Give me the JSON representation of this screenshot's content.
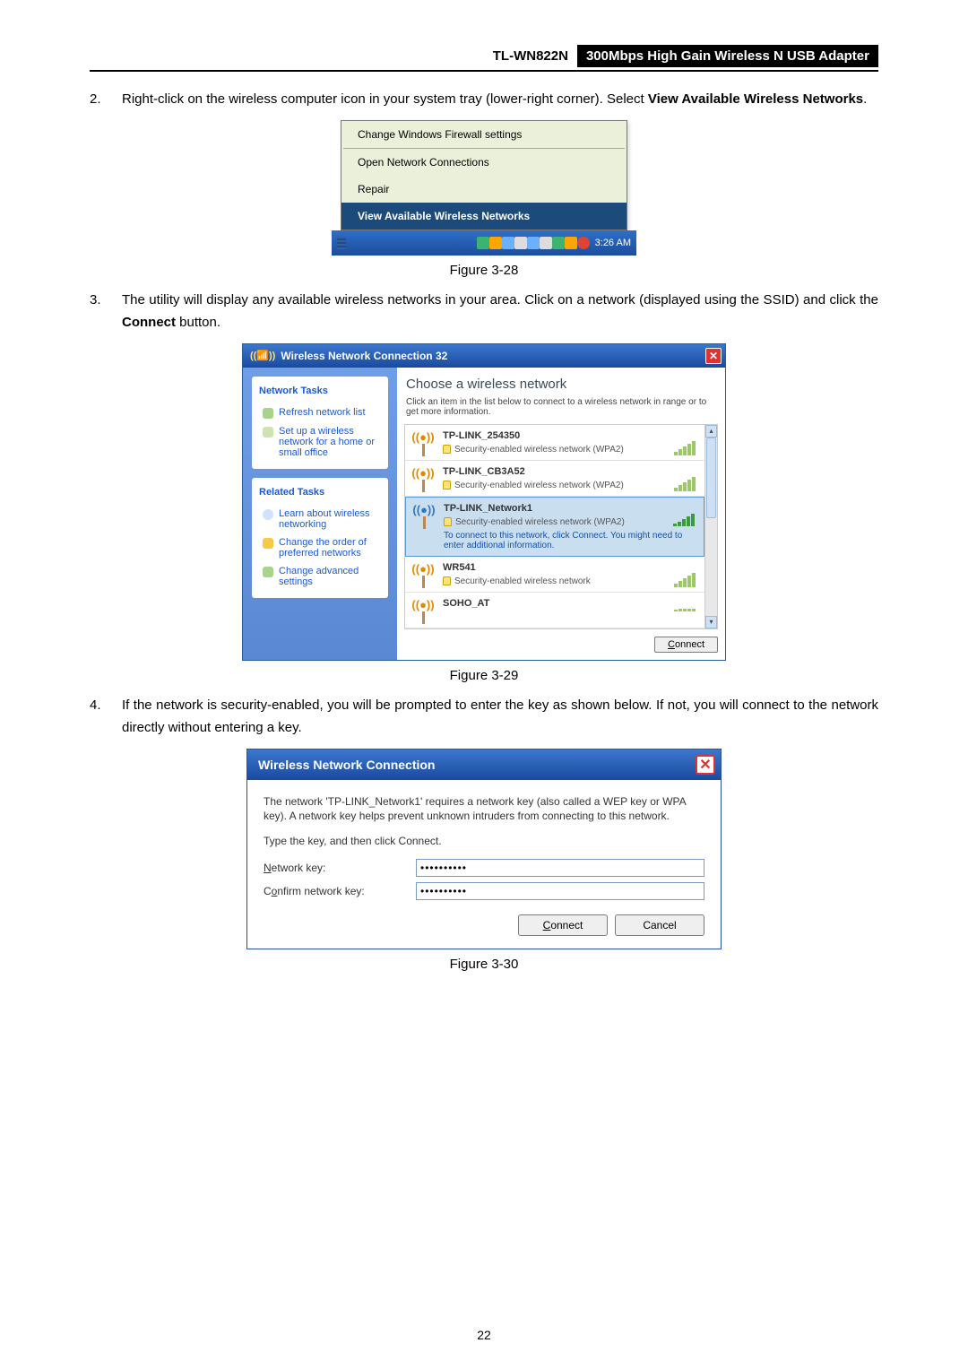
{
  "header": {
    "model": "TL-WN822N",
    "description": "300Mbps High Gain Wireless N USB Adapter"
  },
  "steps": {
    "s2": {
      "num": "2.",
      "text_a": "Right-click on the wireless computer icon in your system tray (lower-right corner). Select ",
      "text_b": "View Available Wireless Networks",
      "text_c": "."
    },
    "s3": {
      "num": "3.",
      "text_a": "The utility will display any available wireless networks in your area. Click on a network (displayed using the SSID) and click the ",
      "text_b": "Connect",
      "text_c": " button."
    },
    "s4": {
      "num": "4.",
      "text_a": "If the network is security-enabled, you will be prompted to enter the key as shown below. If not, you will connect to the network directly without entering a key."
    }
  },
  "captions": {
    "c28": "Figure 3-28",
    "c29": "Figure 3-29",
    "c30": "Figure 3-30"
  },
  "tray": {
    "items": [
      "Change Windows Firewall settings",
      "Open Network Connections",
      "Repair",
      "View Available Wireless Networks"
    ],
    "clock": "3:26 AM"
  },
  "dlg29": {
    "title": "Wireless Network Connection 32",
    "side": {
      "network_tasks": "Network Tasks",
      "refresh": "Refresh network list",
      "setup": "Set up a wireless network for a home or small office",
      "related_tasks": "Related Tasks",
      "learn": "Learn about wireless networking",
      "order": "Change the order of preferred networks",
      "adv": "Change advanced settings"
    },
    "main_heading": "Choose a wireless network",
    "hint": "Click an item in the list below to connect to a wireless network in range or to get more information.",
    "networks": [
      {
        "ssid": "TP-LINK_254350",
        "desc": "Security-enabled wireless network (WPA2)",
        "selected": false,
        "bars": [
          4,
          7,
          10,
          13,
          16
        ]
      },
      {
        "ssid": "TP-LINK_CB3A52",
        "desc": "Security-enabled wireless network (WPA2)",
        "selected": false,
        "bars": [
          4,
          7,
          10,
          13,
          16
        ]
      },
      {
        "ssid": "TP-LINK_Network1",
        "desc": "Security-enabled wireless network (WPA2)",
        "selected": true,
        "connect_msg": "To connect to this network, click Connect. You might need to enter additional information.",
        "bars": [
          3,
          5,
          8,
          11,
          14
        ]
      },
      {
        "ssid": "WR541",
        "desc": "Security-enabled wireless network",
        "selected": false,
        "bars": [
          4,
          7,
          10,
          13,
          16
        ]
      },
      {
        "ssid": "SOHO_AT",
        "desc": "",
        "selected": false,
        "bars": [
          2,
          3,
          3,
          3,
          3
        ]
      }
    ],
    "connect_btn": "Connect"
  },
  "dlg30": {
    "title": "Wireless Network Connection",
    "desc": "The network 'TP-LINK_Network1' requires a network key (also called a WEP key or WPA key). A network key helps prevent unknown intruders from connecting to this network.",
    "type_msg": "Type the key, and then click Connect.",
    "key_label": "Network key:",
    "confirm_label": "Confirm network key:",
    "key_value": "●●●●●●●●●●",
    "connect": "Connect",
    "cancel": "Cancel"
  },
  "page_number": "22"
}
